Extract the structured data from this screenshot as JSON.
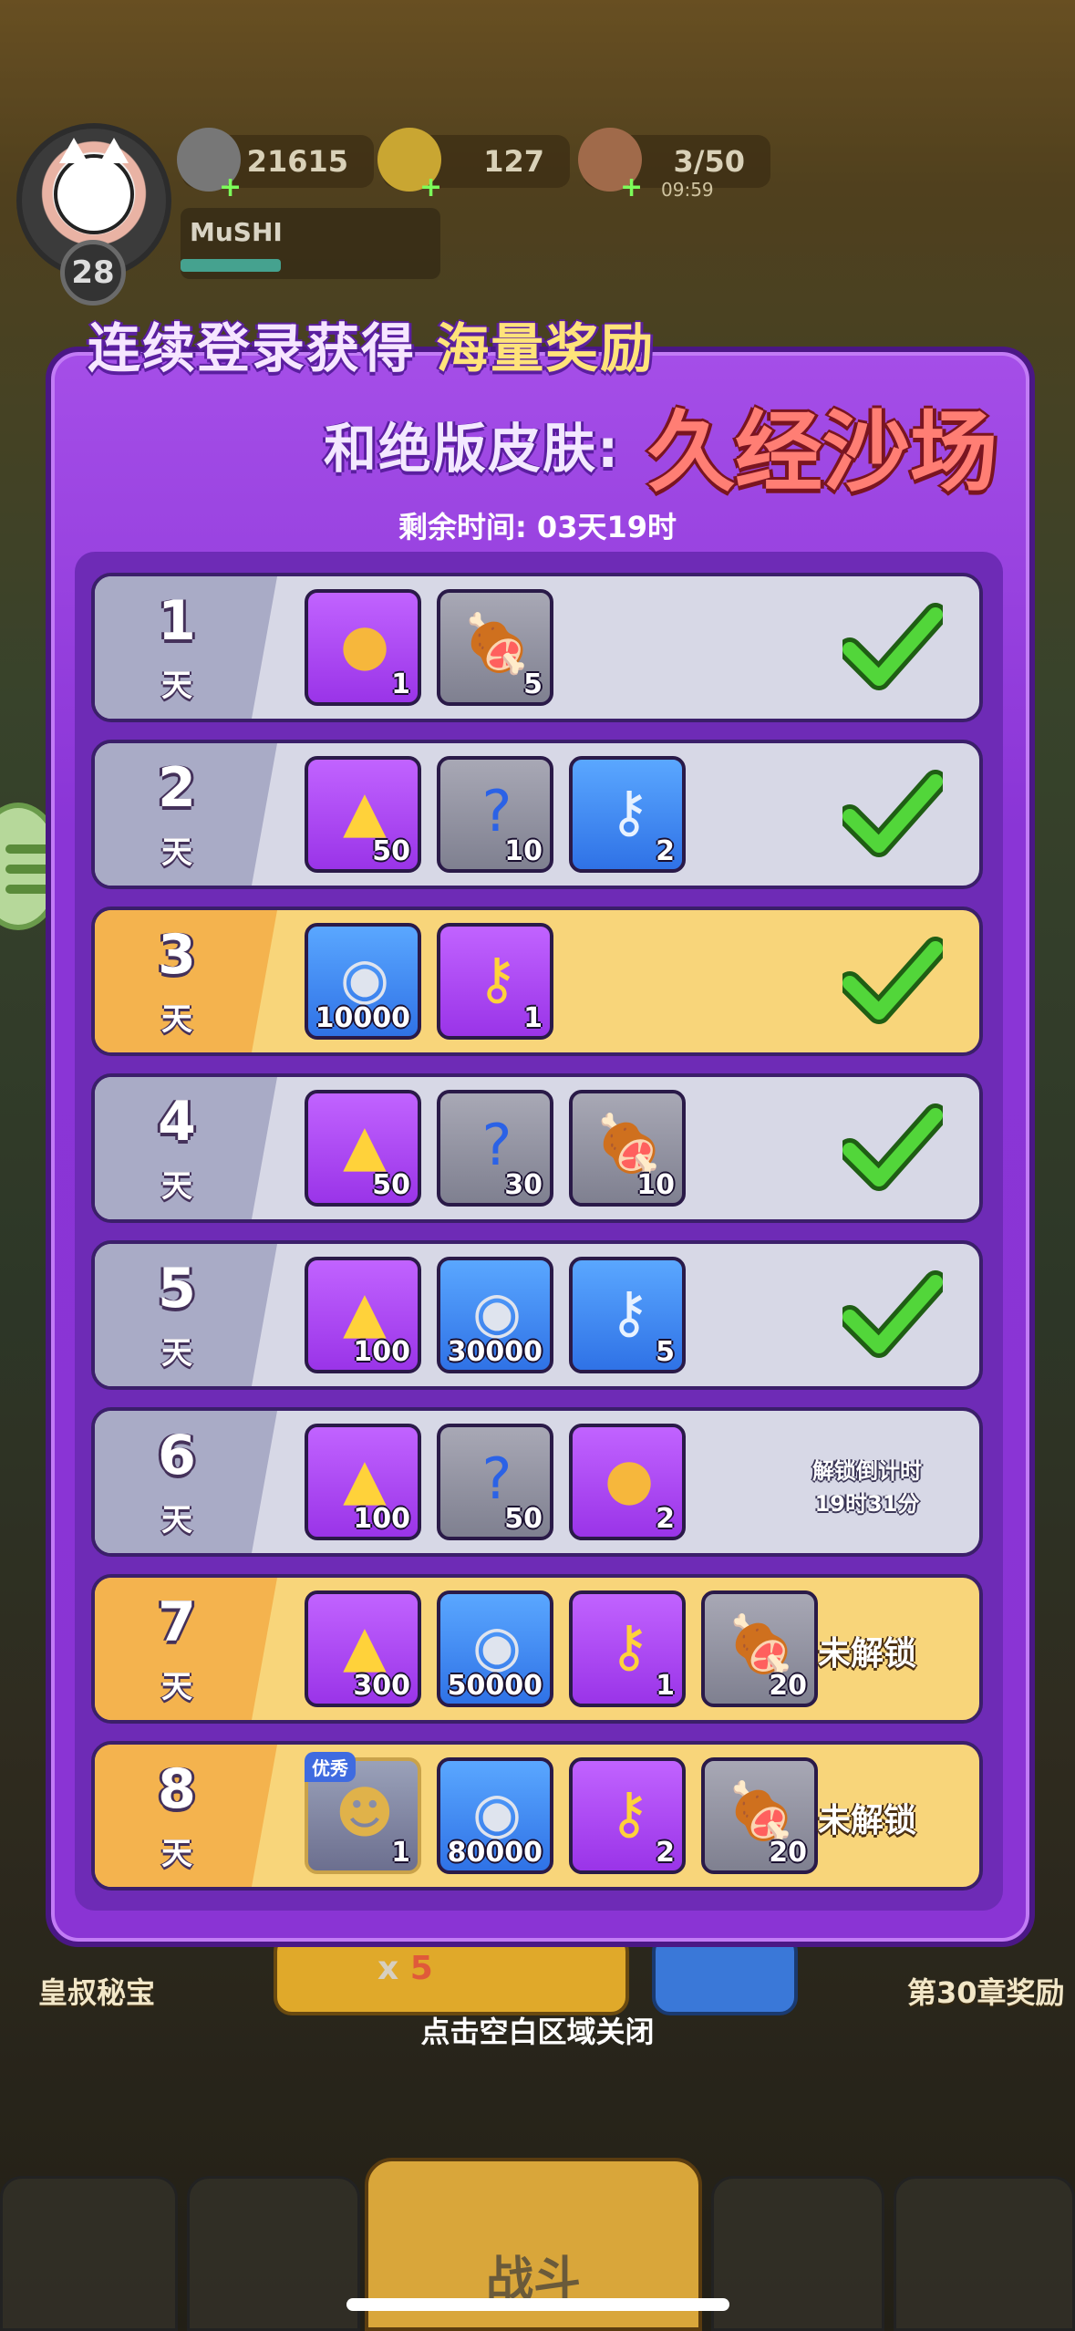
{
  "player": {
    "level": "28",
    "name": "MuSHI"
  },
  "resources": {
    "coins": "21615",
    "ingots": "127",
    "stamina": "3/50",
    "stamina_timer": "09:59"
  },
  "event": {
    "headline_prefix": "连续登录获得",
    "headline_highlight": "海量奖励",
    "headline_line2": "和绝版皮肤:",
    "skin_name": "久经沙场",
    "remaining_time": "剩余时间: 03天19时"
  },
  "day_label": "天",
  "rows": [
    {
      "day": "1",
      "items": [
        {
          "icon": "gold-coin-icon",
          "qty": "1"
        },
        {
          "icon": "meat-icon",
          "qty": "5"
        }
      ],
      "state": "claimed"
    },
    {
      "day": "2",
      "items": [
        {
          "icon": "gold-ingot-icon",
          "qty": "50"
        },
        {
          "icon": "mystery-gem-icon",
          "qty": "10"
        },
        {
          "icon": "silver-key-icon",
          "qty": "2"
        }
      ],
      "state": "claimed"
    },
    {
      "day": "3",
      "items": [
        {
          "icon": "silver-coin-icon",
          "qty": "10000"
        },
        {
          "icon": "gold-key-icon",
          "qty": "1"
        }
      ],
      "state": "claimed"
    },
    {
      "day": "4",
      "items": [
        {
          "icon": "gold-ingot-icon",
          "qty": "50"
        },
        {
          "icon": "mystery-gem-icon",
          "qty": "30"
        },
        {
          "icon": "meat-icon",
          "qty": "10"
        }
      ],
      "state": "claimed"
    },
    {
      "day": "5",
      "items": [
        {
          "icon": "gold-ingot-icon",
          "qty": "100"
        },
        {
          "icon": "silver-coin-icon",
          "qty": "30000"
        },
        {
          "icon": "silver-key-icon",
          "qty": "5"
        }
      ],
      "state": "claimed"
    },
    {
      "day": "6",
      "items": [
        {
          "icon": "gold-ingot-icon",
          "qty": "100"
        },
        {
          "icon": "mystery-gem-icon",
          "qty": "50"
        },
        {
          "icon": "gold-coin-icon",
          "qty": "2"
        }
      ],
      "state": "countdown",
      "countdown_label": "解锁倒计时",
      "countdown": "19时31分"
    },
    {
      "day": "7",
      "items": [
        {
          "icon": "gold-ingot-icon",
          "qty": "300"
        },
        {
          "icon": "silver-coin-icon",
          "qty": "50000"
        },
        {
          "icon": "gold-key-icon",
          "qty": "1"
        },
        {
          "icon": "meat-icon",
          "qty": "20"
        }
      ],
      "state": "locked",
      "status": "未解锁"
    },
    {
      "day": "8",
      "items": [
        {
          "icon": "hero-icon",
          "qty": "1",
          "tag": "优秀"
        },
        {
          "icon": "silver-coin-icon",
          "qty": "80000"
        },
        {
          "icon": "gold-key-icon",
          "qty": "2"
        },
        {
          "icon": "meat-icon",
          "qty": "20"
        }
      ],
      "state": "locked",
      "status": "未解锁"
    }
  ],
  "background": {
    "left_label": "皇叔秘宝",
    "right_label": "第30章奖励",
    "pill_prefix": "x",
    "pill_count": "5",
    "battle_label": "战斗"
  },
  "close_hint": "点击空白区域关闭",
  "colors": {
    "panel": "#8a35d6",
    "row_default": "#d7d8e6",
    "row_gold": "#f8d57a",
    "check": "#52d63a"
  }
}
